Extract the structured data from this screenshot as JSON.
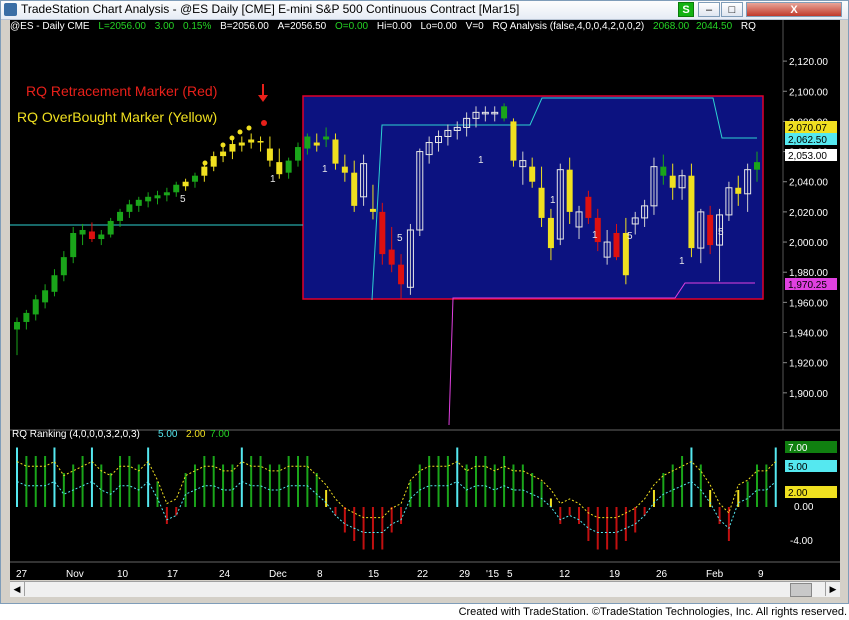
{
  "window": {
    "title": "TradeStation Chart Analysis - @ES Daily [CME] E-mini S&P 500 Continuous Contract [Mar15]"
  },
  "titlebar_buttons": {
    "s": "S",
    "minimize": "–",
    "restore": "□",
    "close": "X"
  },
  "status": {
    "symbol": "@ES - Daily  CME",
    "last": "L=2056.00",
    "change": "3.00",
    "pct": "0.15%",
    "bid": "B=2056.00",
    "ask": "A=2056.50",
    "open": "O=0.00",
    "hi": "Hi=0.00",
    "lo": "Lo=0.00",
    "vol": "V=0",
    "study": "RQ Analysis (false,4,0,0,4,2,0,0,2)",
    "val1": "2068.00",
    "val2": "2044.50",
    "rq": "RQ"
  },
  "legend": {
    "red_marker": "RQ Retracement Marker (Red)",
    "yellow_marker": "RQ OverBought Marker (Yellow)"
  },
  "price_axis": [
    "2,120.00",
    "2,100.00",
    "2,080.00",
    "2,060.00",
    "2,040.00",
    "2,020.00",
    "2,000.00",
    "1,980.00",
    "1,960.00",
    "1,940.00",
    "1,920.00",
    "1,900.00"
  ],
  "price_tags": {
    "t1": "2,070.07",
    "t2": "2,062.50",
    "t3": "2,053.00",
    "t4": "1,970.25"
  },
  "indicator": {
    "label": "RQ Ranking (4,0,0,0,3,2,0,3)",
    "v1": "5.00",
    "v2": "2.00",
    "v3": "7.00",
    "axis": [
      "7.00",
      "5.00",
      "2.00",
      "0.00",
      "-4.00"
    ]
  },
  "bar_labels": [
    "5",
    "1",
    "1",
    "5",
    "1",
    "1",
    "1",
    "5",
    "1",
    "5"
  ],
  "x_axis": [
    "27",
    "Nov",
    "10",
    "17",
    "24",
    "Dec",
    "8",
    "15",
    "22",
    "29",
    "'15",
    "5",
    "12",
    "19",
    "26",
    "Feb",
    "9"
  ],
  "credit": "Created with TradeStation. ©TradeStation Technologies, Inc. All rights reserved.",
  "chart_data": {
    "type": "candlestick",
    "yrange": [
      1880,
      2132
    ],
    "candles": [
      [
        1942,
        1950,
        1925,
        1947,
        "g"
      ],
      [
        1947,
        1955,
        1942,
        1953,
        "g"
      ],
      [
        1952,
        1965,
        1948,
        1962,
        "g"
      ],
      [
        1960,
        1972,
        1956,
        1968,
        "g"
      ],
      [
        1967,
        1982,
        1964,
        1978,
        "g"
      ],
      [
        1978,
        1994,
        1974,
        1990,
        "g"
      ],
      [
        1990,
        2010,
        1986,
        2006,
        "g"
      ],
      [
        2005,
        2012,
        1998,
        2008,
        "g"
      ],
      [
        2007,
        2013,
        2000,
        2002,
        "r"
      ],
      [
        2002,
        2008,
        1998,
        2005,
        "g"
      ],
      [
        2005,
        2016,
        2003,
        2014,
        "g"
      ],
      [
        2014,
        2022,
        2010,
        2020,
        "g"
      ],
      [
        2020,
        2028,
        2016,
        2025,
        "g"
      ],
      [
        2024,
        2030,
        2020,
        2028,
        "g"
      ],
      [
        2027,
        2033,
        2023,
        2030,
        "g"
      ],
      [
        2029,
        2034,
        2025,
        2031,
        "g"
      ],
      [
        2031,
        2036,
        2027,
        2033,
        "g"
      ],
      [
        2033,
        2040,
        2030,
        2038,
        "g"
      ],
      [
        2037,
        2042,
        2034,
        2040,
        "y"
      ],
      [
        2040,
        2046,
        2036,
        2044,
        "g"
      ],
      [
        2044,
        2052,
        2040,
        2050,
        "y"
      ],
      [
        2050,
        2060,
        2047,
        2057,
        "y"
      ],
      [
        2057,
        2064,
        2053,
        2060,
        "y"
      ],
      [
        2060,
        2068,
        2055,
        2065,
        "y"
      ],
      [
        2064,
        2070,
        2060,
        2066,
        "y"
      ],
      [
        2066,
        2072,
        2062,
        2068,
        "y"
      ],
      [
        2067,
        2070,
        2060,
        2066,
        "y"
      ],
      [
        2062,
        2070,
        2050,
        2054,
        "y"
      ],
      [
        2053,
        2062,
        2042,
        2045,
        "y"
      ],
      [
        2046,
        2056,
        2042,
        2054,
        "g"
      ],
      [
        2054,
        2066,
        2050,
        2063,
        "g"
      ],
      [
        2062,
        2072,
        2058,
        2070,
        "g"
      ],
      [
        2066,
        2072,
        2060,
        2064,
        "y"
      ],
      [
        2068,
        2076,
        2063,
        2070,
        "g"
      ],
      [
        2068,
        2072,
        2048,
        2052,
        "y"
      ],
      [
        2050,
        2058,
        2040,
        2046,
        "y"
      ],
      [
        2046,
        2054,
        2020,
        2024,
        "y"
      ],
      [
        2030,
        2058,
        2024,
        2052,
        "w"
      ],
      [
        2022,
        2038,
        2015,
        2020,
        "y"
      ],
      [
        2020,
        2026,
        1985,
        1992,
        "r"
      ],
      [
        1995,
        2010,
        1980,
        1985,
        "r"
      ],
      [
        1985,
        1992,
        1962,
        1972,
        "r"
      ],
      [
        1970,
        2012,
        1965,
        2008,
        "w"
      ],
      [
        2008,
        2062,
        2004,
        2060,
        "w"
      ],
      [
        2058,
        2070,
        2052,
        2066,
        "w"
      ],
      [
        2066,
        2074,
        2060,
        2070,
        "w"
      ],
      [
        2070,
        2078,
        2064,
        2074,
        "w"
      ],
      [
        2074,
        2080,
        2068,
        2076,
        "w"
      ],
      [
        2076,
        2086,
        2070,
        2082,
        "w"
      ],
      [
        2082,
        2090,
        2076,
        2086,
        "w"
      ],
      [
        2086,
        2090,
        2080,
        2085,
        "w"
      ],
      [
        2085,
        2090,
        2080,
        2086,
        "w"
      ],
      [
        2090,
        2092,
        2080,
        2082,
        "g"
      ],
      [
        2080,
        2082,
        2050,
        2054,
        "y"
      ],
      [
        2054,
        2060,
        2038,
        2050,
        "w"
      ],
      [
        2050,
        2056,
        2036,
        2040,
        "y"
      ],
      [
        2036,
        2050,
        2010,
        2016,
        "y"
      ],
      [
        2016,
        2022,
        1988,
        1996,
        "y"
      ],
      [
        2002,
        2052,
        1998,
        2048,
        "w"
      ],
      [
        2048,
        2056,
        2012,
        2020,
        "y"
      ],
      [
        2020,
        2024,
        2002,
        2010,
        "w"
      ],
      [
        2030,
        2034,
        2012,
        2016,
        "r"
      ],
      [
        2016,
        2022,
        1994,
        2000,
        "r"
      ],
      [
        2000,
        2008,
        1985,
        1990,
        "w"
      ],
      [
        1990,
        2012,
        1988,
        2006,
        "r"
      ],
      [
        2006,
        2016,
        1972,
        1978,
        "y"
      ],
      [
        2012,
        2020,
        2005,
        2016,
        "w"
      ],
      [
        2016,
        2028,
        2010,
        2024,
        "w"
      ],
      [
        2024,
        2056,
        2018,
        2050,
        "w"
      ],
      [
        2050,
        2058,
        2038,
        2044,
        "g"
      ],
      [
        2044,
        2052,
        2028,
        2036,
        "y"
      ],
      [
        2036,
        2048,
        2028,
        2044,
        "w"
      ],
      [
        2044,
        2052,
        1990,
        1996,
        "y"
      ],
      [
        1996,
        2022,
        1986,
        2020,
        "w"
      ],
      [
        2018,
        2024,
        1992,
        1998,
        "r"
      ],
      [
        1998,
        2022,
        1974,
        2018,
        "w"
      ],
      [
        2018,
        2040,
        2014,
        2036,
        "w"
      ],
      [
        2036,
        2044,
        2024,
        2032,
        "y"
      ],
      [
        2032,
        2052,
        2020,
        2048,
        "w"
      ],
      [
        2048,
        2060,
        2040,
        2053,
        "g"
      ]
    ]
  }
}
